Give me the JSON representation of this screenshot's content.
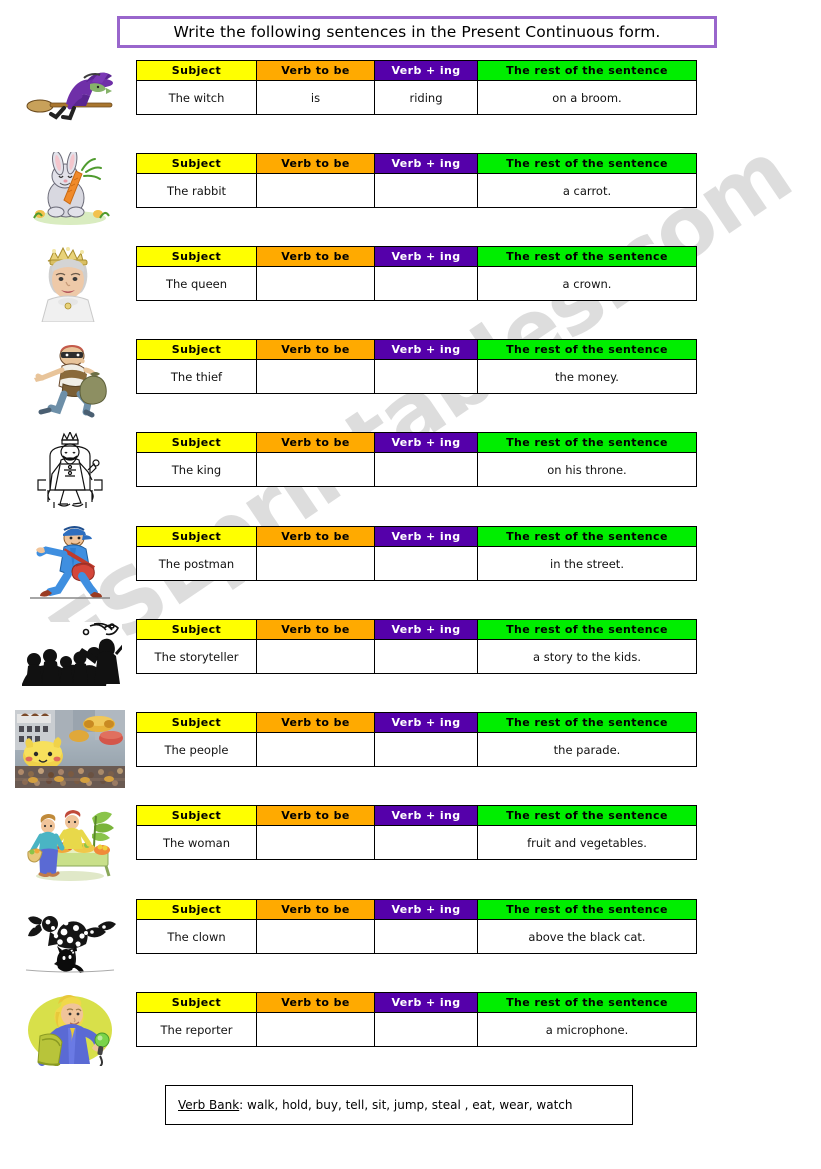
{
  "title": {
    "text": "Write the following sentences in the Present Continuous form."
  },
  "watermark": {
    "text": "ESLprintables.com"
  },
  "table_headers": {
    "subject": "Subject",
    "verb_to_be": "Verb to be",
    "verb_ing": "Verb +  ing",
    "rest": "The rest of the sentence"
  },
  "colors": {
    "subject_header": "#ffff00",
    "verb_to_be_header": "#ffaa00",
    "verb_ing_header": "#5500aa",
    "rest_header": "#00ee00",
    "title_border": "#9966cc"
  },
  "rows": [
    {
      "icon": "witch-on-broom-icon",
      "subject": "The witch",
      "verb_to_be": "is",
      "verb_ing": "riding",
      "rest": "on a broom."
    },
    {
      "icon": "rabbit-with-carrot-icon",
      "subject": "The rabbit",
      "verb_to_be": "",
      "verb_ing": "",
      "rest": "a carrot."
    },
    {
      "icon": "queen-with-crown-icon",
      "subject": "The queen",
      "verb_to_be": "",
      "verb_ing": "",
      "rest": "a crown."
    },
    {
      "icon": "thief-with-sack-icon",
      "subject": "The thief",
      "verb_to_be": "",
      "verb_ing": "",
      "rest": "the money."
    },
    {
      "icon": "king-on-throne-icon",
      "subject": "The king",
      "verb_to_be": "",
      "verb_ing": "",
      "rest": "on his throne."
    },
    {
      "icon": "postman-walking-icon",
      "subject": "The postman",
      "verb_to_be": "",
      "verb_ing": "",
      "rest": "in the street."
    },
    {
      "icon": "storyteller-silhouette-icon",
      "subject": "The storyteller",
      "verb_to_be": "",
      "verb_ing": "",
      "rest": "a story to the kids."
    },
    {
      "icon": "parade-crowd-photo-icon",
      "subject": "The people",
      "verb_to_be": "",
      "verb_ing": "",
      "rest": "the parade."
    },
    {
      "icon": "woman-at-market-stall-icon",
      "subject": "The woman",
      "verb_to_be": "",
      "verb_ing": "",
      "rest": "fruit and vegetables."
    },
    {
      "icon": "clown-jumping-over-cat-icon",
      "subject": "The clown",
      "verb_to_be": "",
      "verb_ing": "",
      "rest": "above the black cat."
    },
    {
      "icon": "reporter-with-microphone-icon",
      "subject": "The reporter",
      "verb_to_be": "",
      "verb_ing": "",
      "rest": "a microphone."
    }
  ],
  "verb_bank": {
    "label": "Verb Bank",
    "separator": ": ",
    "verbs": "walk, hold, buy, tell, sit, jump, steal , eat, wear, watch"
  }
}
